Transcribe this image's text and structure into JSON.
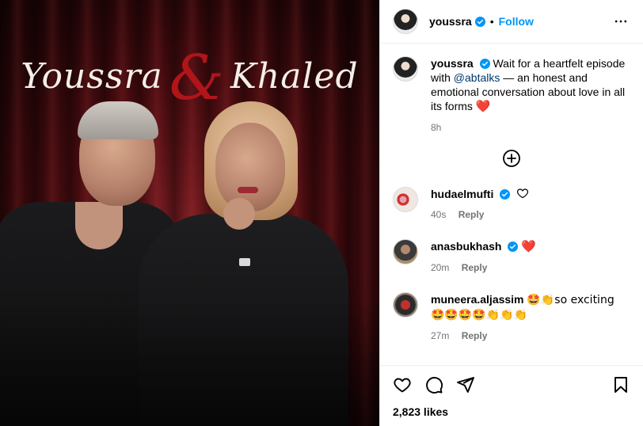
{
  "post": {
    "image_title_left": "Youssra",
    "image_title_amp": "&",
    "image_title_right": "Khaled"
  },
  "header": {
    "username": "youssra",
    "dot": "•",
    "follow_label": "Follow"
  },
  "caption": {
    "username": "youssra",
    "text_before": "Wait for a heartfelt episode with ",
    "mention": "@abtalks",
    "text_after": " — an honest and emotional conversation about love in all its forms",
    "emoji": "❤️",
    "time": "8h"
  },
  "comments": [
    {
      "username": "hudaelmufti",
      "verified": true,
      "text": "",
      "time": "40s",
      "reply_label": "Reply"
    },
    {
      "username": "anasbukhash",
      "verified": true,
      "text": "❤️",
      "time": "20m",
      "reply_label": "Reply"
    },
    {
      "username": "muneera.aljassim",
      "verified": false,
      "text": "🤩👏so exciting 🤩🤩🤩🤩👏👏👏",
      "time": "27m",
      "reply_label": "Reply"
    }
  ],
  "footer": {
    "likes": "2,823 likes"
  },
  "colors": {
    "accent": "#0095f6",
    "verified": "#0095f6",
    "heart": "#e0245e",
    "muted": "#737373"
  }
}
